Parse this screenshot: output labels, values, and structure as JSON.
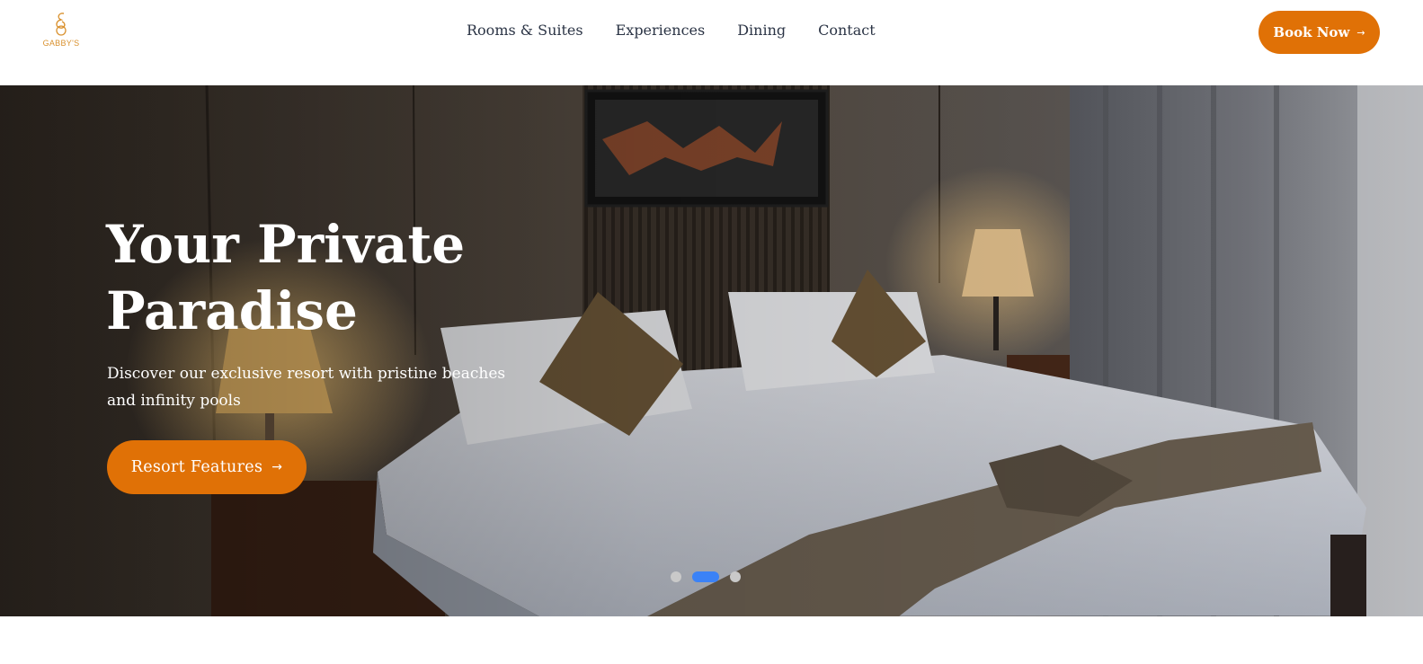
{
  "brand": {
    "logo_text": "GABBY'S",
    "accent_color": "#e07106",
    "logo_color": "#d9912e"
  },
  "nav": {
    "items": [
      {
        "label": "Rooms & Suites"
      },
      {
        "label": "Experiences"
      },
      {
        "label": "Dining"
      },
      {
        "label": "Contact"
      }
    ]
  },
  "header": {
    "book_label": "Book Now",
    "book_icon": "arrow-right-icon"
  },
  "hero": {
    "title": "Your Private Paradise",
    "subtitle": "Discover our exclusive resort with pristine beaches and infinity pools",
    "cta_label": "Resort Features",
    "cta_icon": "arrow-right-icon",
    "slides_total": 3,
    "active_slide": 2,
    "active_dot_color": "#3b82f6"
  }
}
